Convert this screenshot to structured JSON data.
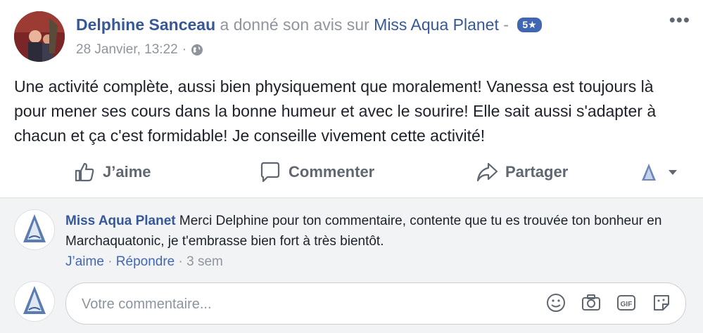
{
  "post": {
    "author": "Delphine Sanceau",
    "verb": "a donné son avis sur",
    "page": "Miss Aqua Planet",
    "separator": "-",
    "rating_badge": "5★",
    "timestamp": "28 Janvier, 13:22",
    "dot": "·",
    "body": "Une activité complète, aussi bien physiquement que moralement! Vanessa est toujours là pour mener ses cours dans la bonne humeur et avec le sourire! Elle sait aussi s'adapter à chacun et ça c'est formidable! Je conseille vivement cette activité!",
    "more_icon": "more-icon"
  },
  "actions": {
    "like_label": "J’aime",
    "comment_label": "Commenter",
    "share_label": "Partager"
  },
  "reply": {
    "author": "Miss Aqua Planet",
    "text": "Merci Delphine pour ton commentaire, contente que tu es trouvée ton bonheur en Marchaquatonic, je t'embrasse bien fort à très bientôt.",
    "like_link": "J’aime",
    "reply_link": "Répondre",
    "age": "3 sem",
    "dot": "·"
  },
  "composer": {
    "placeholder": "Votre commentaire...",
    "gif_label": "GIF"
  },
  "colors": {
    "link_blue": "#365899",
    "badge_blue": "#4267b2",
    "muted": "#90949c",
    "bg_gray": "#f2f3f5"
  }
}
